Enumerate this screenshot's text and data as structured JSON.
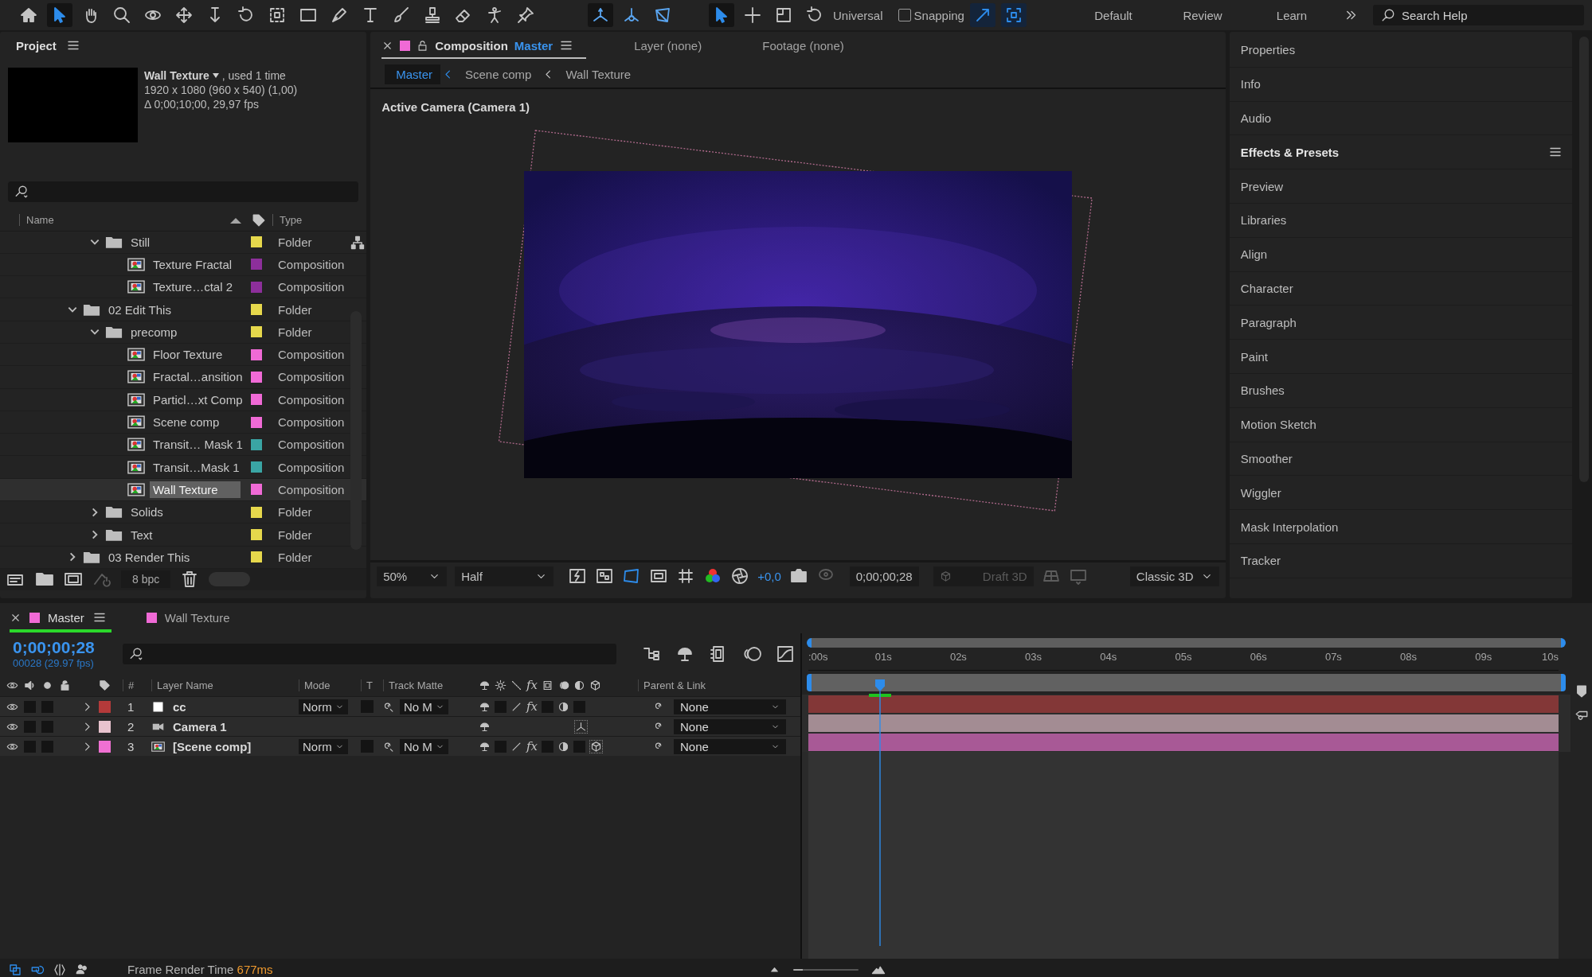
{
  "toolbar": {
    "tools": [
      {
        "selected": false
      },
      {
        "selected": true
      },
      {
        "selected": false
      },
      {
        "selected": false
      },
      {
        "selected": false
      },
      {
        "selected": false
      },
      {
        "selected": false
      },
      {
        "selected": false
      },
      {
        "selected": false
      },
      {
        "selected": false
      },
      {
        "selected": false
      },
      {
        "selected": false
      },
      {
        "selected": false
      },
      {
        "selected": false
      },
      {
        "selected": false
      },
      {
        "selected": false
      },
      {
        "selected": false
      }
    ],
    "axis_tools": [
      {
        "selected": true
      },
      {
        "selected": false
      },
      {
        "selected": false
      }
    ],
    "view_tools": [
      {
        "selected": true
      },
      {
        "selected": false
      },
      {
        "selected": false
      },
      {
        "selected": false
      }
    ],
    "view_mode": "Universal",
    "snapping": {
      "label": "Snapping",
      "checked": false
    },
    "snap_options": [
      {
        "on": true
      },
      {
        "on": true
      }
    ],
    "workspaces": [
      "Default",
      "Review",
      "Learn"
    ],
    "search": {
      "placeholder": "Search Help"
    }
  },
  "project": {
    "title": "Project",
    "preview": {
      "name": "Wall Texture",
      "usage": ", used 1 time",
      "dimensions": "1920 x 1080  (960 x 540) (1,00)",
      "duration": "Δ 0;00;10;00, 29,97 fps"
    },
    "columns": {
      "name": "Name",
      "type": "Type"
    },
    "items": [
      {
        "children": [
          {
            "name": "Still",
            "kind": "folder",
            "type": "Folder",
            "color": "#e6d84c",
            "expanded": true,
            "selected": false,
            "children": [
              {
                "name": "Texture Fractal",
                "kind": "composition",
                "type": "Composition",
                "color": "#8d2f9b",
                "selected": false
              },
              {
                "name": "Texture…ctal 2",
                "kind": "composition",
                "type": "Composition",
                "color": "#8d2f9b",
                "selected": false
              }
            ]
          }
        ]
      },
      {
        "name": "02 Edit This",
        "kind": "folder",
        "type": "Folder",
        "color": "#e6d84c",
        "expanded": true,
        "selected": false,
        "children": [
          {
            "name": "precomp",
            "kind": "folder",
            "type": "Folder",
            "color": "#e6d84c",
            "expanded": true,
            "selected": false,
            "children": [
              {
                "name": "Floor Texture",
                "kind": "composition",
                "type": "Composition",
                "color": "#f06ad6",
                "selected": false
              },
              {
                "name": "Fractal…ansition",
                "kind": "composition",
                "type": "Composition",
                "color": "#f06ad6",
                "selected": false
              },
              {
                "name": "Particl…xt Comp",
                "kind": "composition",
                "type": "Composition",
                "color": "#f06ad6",
                "selected": false
              },
              {
                "name": "Scene comp",
                "kind": "composition",
                "type": "Composition",
                "color": "#f06ad6",
                "selected": false
              },
              {
                "name": "Transit… Mask 1",
                "kind": "composition",
                "type": "Composition",
                "color": "#3aa5a4",
                "selected": false
              },
              {
                "name": "Transit…Mask 1",
                "kind": "composition",
                "type": "Composition",
                "color": "#3aa5a4",
                "selected": false
              },
              {
                "name": "Wall Texture",
                "kind": "composition",
                "type": "Composition",
                "color": "#f06ad6",
                "selected": true
              }
            ]
          },
          {
            "name": "Solids",
            "kind": "folder",
            "type": "Folder",
            "color": "#e6d84c",
            "expanded": false,
            "selected": false
          },
          {
            "name": "Text",
            "kind": "folder",
            "type": "Folder",
            "color": "#e6d84c",
            "expanded": false,
            "selected": false
          }
        ]
      },
      {
        "name": "03 Render This",
        "kind": "folder",
        "type": "Folder",
        "color": "#e6d84c",
        "expanded": false,
        "selected": false
      }
    ],
    "bit_depth": "8 bpc"
  },
  "comp": {
    "tabs": [
      {
        "label": "Composition",
        "name": "Master",
        "color": "#f06ad6",
        "selected": true
      },
      {
        "label": "Layer (none)",
        "selected": false
      },
      {
        "label": "Footage (none)",
        "selected": false
      }
    ],
    "breadcrumbs": [
      {
        "label": "Master",
        "selected": true
      },
      {
        "label": "Scene comp",
        "selected": false
      },
      {
        "label": "Wall Texture",
        "selected": false
      }
    ],
    "view_label": "Active Camera (Camera 1)",
    "footer": {
      "zoom": "50%",
      "resolution": "Half",
      "exposure": "+0,0",
      "timecode": "0;00;00;28",
      "draft_3d": {
        "label": "Draft 3D",
        "disabled": true
      },
      "renderer": "Classic 3D"
    }
  },
  "panels": [
    {
      "label": "Properties",
      "active": false
    },
    {
      "label": "Info",
      "active": false
    },
    {
      "label": "Audio",
      "active": false
    },
    {
      "label": "Effects & Presets",
      "active": true
    },
    {
      "label": "Preview",
      "active": false
    },
    {
      "label": "Libraries",
      "active": false
    },
    {
      "label": "Align",
      "active": false
    },
    {
      "label": "Character",
      "active": false
    },
    {
      "label": "Paragraph",
      "active": false
    },
    {
      "label": "Paint",
      "active": false
    },
    {
      "label": "Brushes",
      "active": false
    },
    {
      "label": "Motion Sketch",
      "active": false
    },
    {
      "label": "Smoother",
      "active": false
    },
    {
      "label": "Wiggler",
      "active": false
    },
    {
      "label": "Mask Interpolation",
      "active": false
    },
    {
      "label": "Tracker",
      "active": false
    }
  ],
  "timeline": {
    "tabs": [
      {
        "label": "Master",
        "color": "#f06ad6",
        "selected": true
      },
      {
        "label": "Wall Texture",
        "color": "#f06ad6",
        "selected": false
      }
    ],
    "timecode": "0;00;00;28",
    "frame_info": "00028 (29.97 fps)",
    "columns": {
      "number": "#",
      "layer_name": "Layer Name",
      "mode": "Mode",
      "t": "T",
      "track_matte": "Track Matte",
      "effects": "fx",
      "parent": "Parent & Link"
    },
    "layers": [
      {
        "number": "1",
        "kind": "solid",
        "name": "cc",
        "color": "#b43a3a",
        "visible": true,
        "mode": "Norm",
        "track_matte": "No M",
        "effects": "fx",
        "parent": "None"
      },
      {
        "number": "2",
        "kind": "camera",
        "name": "Camera 1",
        "color": "#e8c3ce",
        "visible": true,
        "parent": "None"
      },
      {
        "number": "3",
        "kind": "composition",
        "name": "[Scene comp]",
        "color": "#f070d2",
        "visible": true,
        "mode": "Norm",
        "track_matte": "No M",
        "effects": "fx",
        "parent": "None"
      }
    ],
    "ruler": [
      ":00s",
      "01s",
      "02s",
      "03s",
      "04s",
      "05s",
      "06s",
      "07s",
      "08s",
      "09s",
      "10s"
    ],
    "playhead": {
      "level": 0.093
    }
  },
  "status": {
    "label": "Frame Render Time",
    "value": "677ms"
  }
}
